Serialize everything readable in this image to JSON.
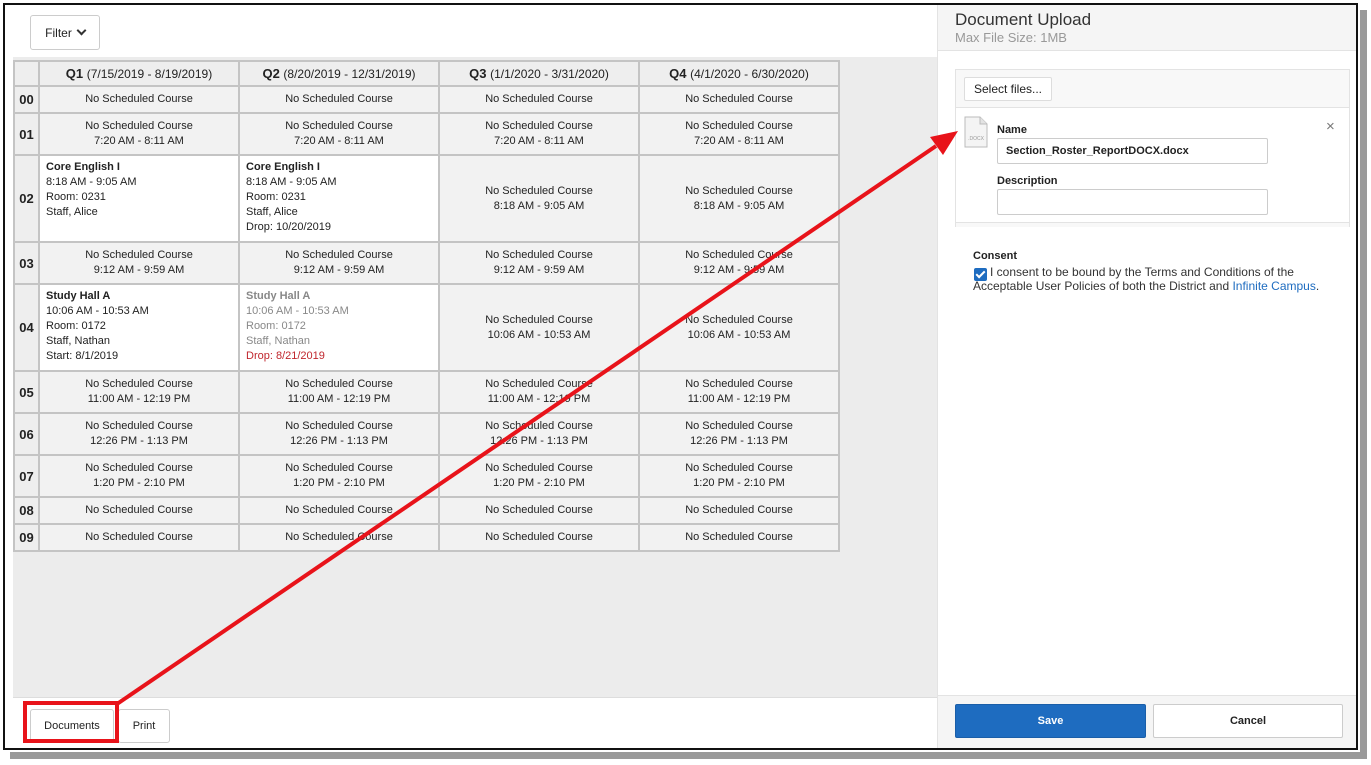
{
  "toolbar": {
    "filter_label": "Filter"
  },
  "schedule": {
    "terms": [
      {
        "name": "Q1",
        "dates": "(7/15/2019 - 8/19/2019)"
      },
      {
        "name": "Q2",
        "dates": "(8/20/2019 - 12/31/2019)"
      },
      {
        "name": "Q3",
        "dates": "(1/1/2020 - 3/31/2020)"
      },
      {
        "name": "Q4",
        "dates": "(4/1/2020 - 6/30/2020)"
      }
    ],
    "periods": [
      {
        "period": "00",
        "cells": [
          {
            "kind": "empty",
            "lines": [
              "No Scheduled Course"
            ]
          },
          {
            "kind": "empty",
            "lines": [
              "No Scheduled Course"
            ]
          },
          {
            "kind": "empty",
            "lines": [
              "No Scheduled Course"
            ]
          },
          {
            "kind": "empty",
            "lines": [
              "No Scheduled Course"
            ]
          }
        ]
      },
      {
        "period": "01",
        "cells": [
          {
            "kind": "empty",
            "lines": [
              "No Scheduled Course",
              "7:20 AM - 8:11 AM"
            ]
          },
          {
            "kind": "empty",
            "lines": [
              "No Scheduled Course",
              "7:20 AM - 8:11 AM"
            ]
          },
          {
            "kind": "empty",
            "lines": [
              "No Scheduled Course",
              "7:20 AM - 8:11 AM"
            ]
          },
          {
            "kind": "empty",
            "lines": [
              "No Scheduled Course",
              "7:20 AM - 8:11 AM"
            ]
          }
        ]
      },
      {
        "period": "02",
        "cells": [
          {
            "kind": "course",
            "title": "Core English I",
            "lines": [
              "8:18 AM - 9:05 AM",
              "Room: 0231",
              "Staff, Alice"
            ]
          },
          {
            "kind": "course",
            "title": "Core English I",
            "lines": [
              "8:18 AM - 9:05 AM",
              "Room: 0231",
              "Staff, Alice",
              "Drop: 10/20/2019"
            ]
          },
          {
            "kind": "empty",
            "lines": [
              "No Scheduled Course",
              "8:18 AM - 9:05 AM"
            ]
          },
          {
            "kind": "empty",
            "lines": [
              "No Scheduled Course",
              "8:18 AM - 9:05 AM"
            ]
          }
        ]
      },
      {
        "period": "03",
        "cells": [
          {
            "kind": "empty",
            "lines": [
              "No Scheduled Course",
              "9:12 AM - 9:59 AM"
            ]
          },
          {
            "kind": "empty",
            "lines": [
              "No Scheduled Course",
              "9:12 AM - 9:59 AM"
            ]
          },
          {
            "kind": "empty",
            "lines": [
              "No Scheduled Course",
              "9:12 AM - 9:59 AM"
            ]
          },
          {
            "kind": "empty",
            "lines": [
              "No Scheduled Course",
              "9:12 AM - 9:59 AM"
            ]
          }
        ]
      },
      {
        "period": "04",
        "cells": [
          {
            "kind": "course",
            "title": "Study Hall A",
            "lines": [
              "10:06 AM - 10:53 AM",
              "Room: 0172",
              "Staff, Nathan",
              "Start: 8/1/2019"
            ]
          },
          {
            "kind": "dropped",
            "title": "Study Hall A",
            "lines": [
              "10:06 AM - 10:53 AM",
              "Room: 0172",
              "Staff, Nathan"
            ],
            "drop": "Drop: 8/21/2019"
          },
          {
            "kind": "empty",
            "lines": [
              "No Scheduled Course",
              "10:06 AM - 10:53 AM"
            ]
          },
          {
            "kind": "empty",
            "lines": [
              "No Scheduled Course",
              "10:06 AM - 10:53 AM"
            ]
          }
        ]
      },
      {
        "period": "05",
        "cells": [
          {
            "kind": "empty",
            "lines": [
              "No Scheduled Course",
              "11:00 AM - 12:19 PM"
            ]
          },
          {
            "kind": "empty",
            "lines": [
              "No Scheduled Course",
              "11:00 AM - 12:19 PM"
            ]
          },
          {
            "kind": "empty",
            "lines": [
              "No Scheduled Course",
              "11:00 AM - 12:19 PM"
            ]
          },
          {
            "kind": "empty",
            "lines": [
              "No Scheduled Course",
              "11:00 AM - 12:19 PM"
            ]
          }
        ]
      },
      {
        "period": "06",
        "cells": [
          {
            "kind": "empty",
            "lines": [
              "No Scheduled Course",
              "12:26 PM - 1:13 PM"
            ]
          },
          {
            "kind": "empty",
            "lines": [
              "No Scheduled Course",
              "12:26 PM - 1:13 PM"
            ]
          },
          {
            "kind": "empty",
            "lines": [
              "No Scheduled Course",
              "12:26 PM - 1:13 PM"
            ]
          },
          {
            "kind": "empty",
            "lines": [
              "No Scheduled Course",
              "12:26 PM - 1:13 PM"
            ]
          }
        ]
      },
      {
        "period": "07",
        "cells": [
          {
            "kind": "empty",
            "lines": [
              "No Scheduled Course",
              "1:20 PM - 2:10 PM"
            ]
          },
          {
            "kind": "empty",
            "lines": [
              "No Scheduled Course",
              "1:20 PM - 2:10 PM"
            ]
          },
          {
            "kind": "empty",
            "lines": [
              "No Scheduled Course",
              "1:20 PM - 2:10 PM"
            ]
          },
          {
            "kind": "empty",
            "lines": [
              "No Scheduled Course",
              "1:20 PM - 2:10 PM"
            ]
          }
        ]
      },
      {
        "period": "08",
        "cells": [
          {
            "kind": "empty",
            "lines": [
              "No Scheduled Course"
            ]
          },
          {
            "kind": "empty",
            "lines": [
              "No Scheduled Course"
            ]
          },
          {
            "kind": "empty",
            "lines": [
              "No Scheduled Course"
            ]
          },
          {
            "kind": "empty",
            "lines": [
              "No Scheduled Course"
            ]
          }
        ]
      },
      {
        "period": "09",
        "cells": [
          {
            "kind": "empty",
            "lines": [
              "No Scheduled Course"
            ]
          },
          {
            "kind": "empty",
            "lines": [
              "No Scheduled Course"
            ]
          },
          {
            "kind": "empty",
            "lines": [
              "No Scheduled Course"
            ]
          },
          {
            "kind": "empty",
            "lines": [
              "No Scheduled Course"
            ]
          }
        ]
      }
    ]
  },
  "footer": {
    "documents_label": "Documents",
    "print_label": "Print"
  },
  "upload_panel": {
    "title": "Document Upload",
    "subtitle": "Max File Size: 1MB",
    "select_files_label": "Select files...",
    "file_icon_text": ".DOCX",
    "name_label": "Name",
    "name_value": "Section_Roster_ReportDOCX.docx",
    "description_label": "Description",
    "description_value": "",
    "close_glyph": "×",
    "consent_label": "Consent",
    "consent_checked": true,
    "consent_text": "I consent to be bound by the Terms and Conditions of the Acceptable User Policies of both the District and ",
    "consent_link": "Infinite Campus",
    "consent_end": ".",
    "save_label": "Save",
    "cancel_label": "Cancel"
  },
  "colors": {
    "accent": "#1e6cc0",
    "annotation": "#e8131a",
    "drop": "#c0262d"
  },
  "icons": [
    "chevron-down-icon",
    "file-docx-icon",
    "close-icon",
    "checkbox-icon"
  ]
}
